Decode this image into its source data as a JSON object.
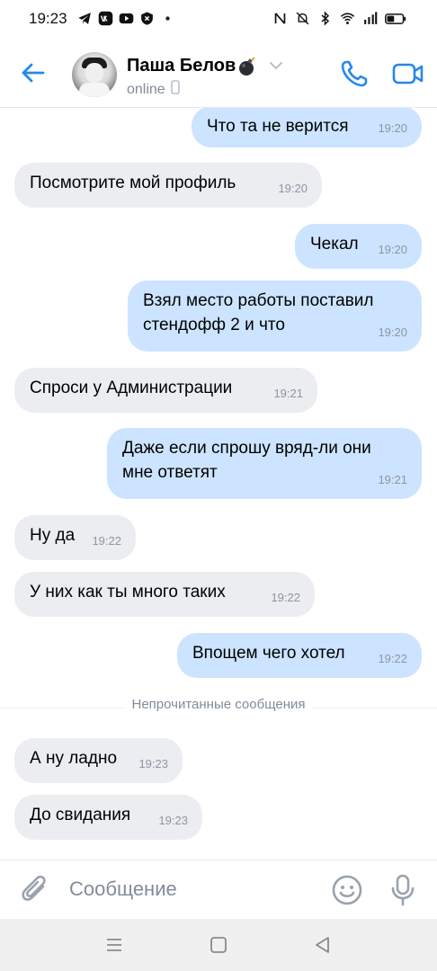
{
  "status_bar": {
    "time": "19:23"
  },
  "header": {
    "contact_name": "Паша Белов",
    "presence": "online"
  },
  "messages": [
    {
      "dir": "out",
      "text": "Что та не верится",
      "time": "19:20"
    },
    {
      "dir": "in",
      "text": "Посмотрите мой профиль",
      "time": "19:20"
    },
    {
      "dir": "out",
      "text": "Чекал",
      "time": "19:20"
    },
    {
      "dir": "out",
      "text": "Взял место работы поставил стендофф 2 и что",
      "time": "19:20"
    },
    {
      "dir": "in",
      "text": "Спроси у Администрации",
      "time": "19:21"
    },
    {
      "dir": "out",
      "text": "Даже если спрошу вряд-ли они мне ответят",
      "time": "19:21"
    },
    {
      "dir": "in",
      "text": "Ну да",
      "time": "19:22"
    },
    {
      "dir": "in",
      "text": "У них как ты много таких",
      "time": "19:22"
    },
    {
      "dir": "out",
      "text": "Впощем чего хотел",
      "time": "19:22"
    },
    {
      "dir": "in",
      "text": "А ну ладно",
      "time": "19:23"
    },
    {
      "dir": "in",
      "text": "До свидания",
      "time": "19:23"
    }
  ],
  "unread_divider": "Непрочитанные сообщения",
  "composer": {
    "placeholder": "Сообщение"
  },
  "colors": {
    "accent": "#2688eb",
    "incoming_bubble": "#ebedf0",
    "outgoing_bubble": "#cce4ff",
    "secondary_text": "#818c99"
  },
  "icons": {
    "header": [
      "back-arrow-icon",
      "bomb-emoji-icon",
      "chevron-down-icon",
      "mobile-device-icon",
      "phone-icon",
      "video-camera-icon"
    ],
    "composer": [
      "paperclip-icon",
      "smiley-icon",
      "microphone-icon"
    ],
    "nav": [
      "menu-icon",
      "home-square-icon",
      "back-triangle-icon"
    ]
  }
}
